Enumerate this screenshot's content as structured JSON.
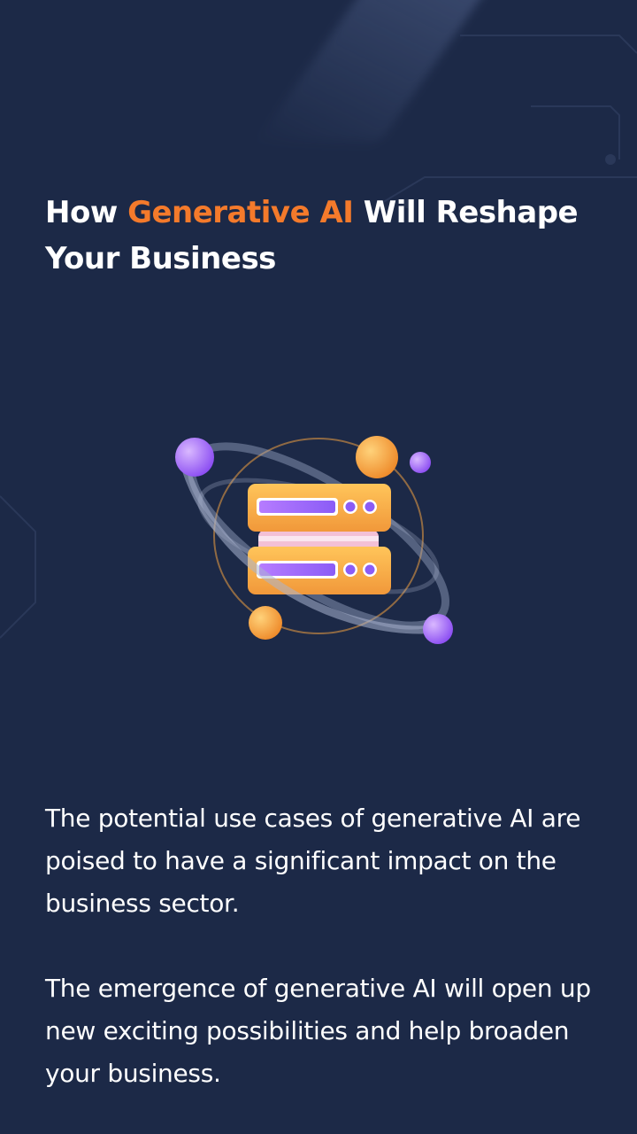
{
  "hero": {
    "title_before": "How ",
    "title_accent": "Generative AI",
    "title_after": " Will Reshape Your Business",
    "accent_color": "#f47a2b",
    "illustration_icon": "server-orbit-icon"
  },
  "body": {
    "paragraph_1": "The potential use cases of generative AI are poised to have a significant impact on the business sector.",
    "paragraph_2": "The emergence of generative AI will open up new exciting possibilities and help broaden your business."
  },
  "theme": {
    "background": "#1c2947",
    "text": "#ffffff"
  }
}
